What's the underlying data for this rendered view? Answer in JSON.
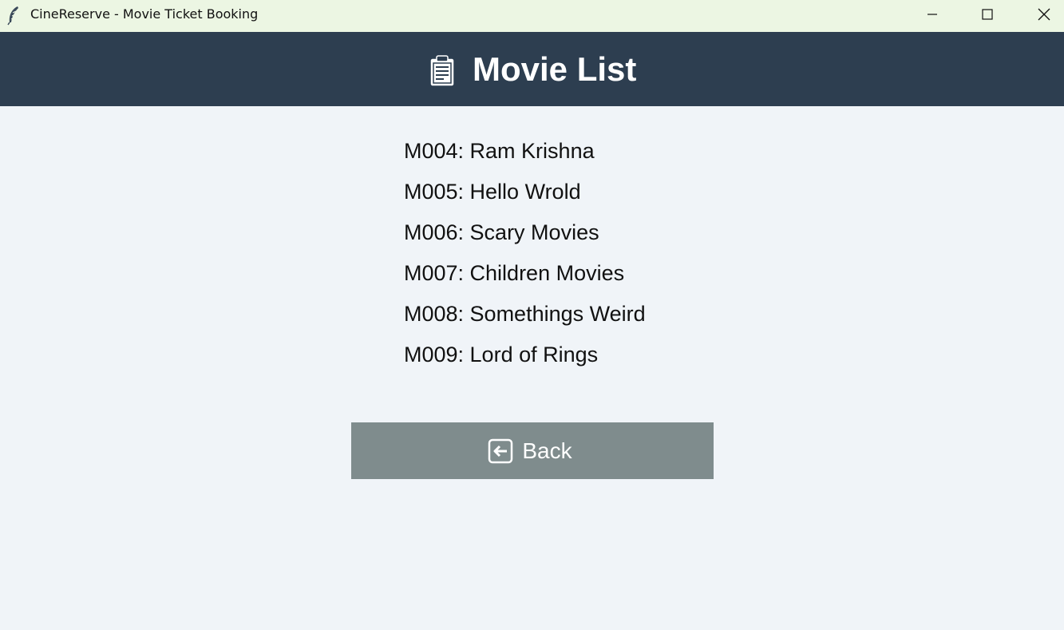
{
  "window": {
    "title": "CineReserve - Movie Ticket Booking",
    "icon": "feather-icon",
    "controls": [
      "minimize-icon",
      "maximize-icon",
      "close-icon"
    ]
  },
  "header": {
    "icon": "clipboard-icon",
    "title": "Movie List",
    "background": "#2d3e50"
  },
  "movies": [
    "M004: Ram Krishna",
    "M005: Hello Wrold",
    "M006: Scary Movies",
    "M007: Children Movies",
    "M008: Somethings Weird",
    "M009: Lord of Rings"
  ],
  "back_button": {
    "icon": "back-arrow-icon",
    "label": "Back",
    "background": "#7f8c8d"
  }
}
